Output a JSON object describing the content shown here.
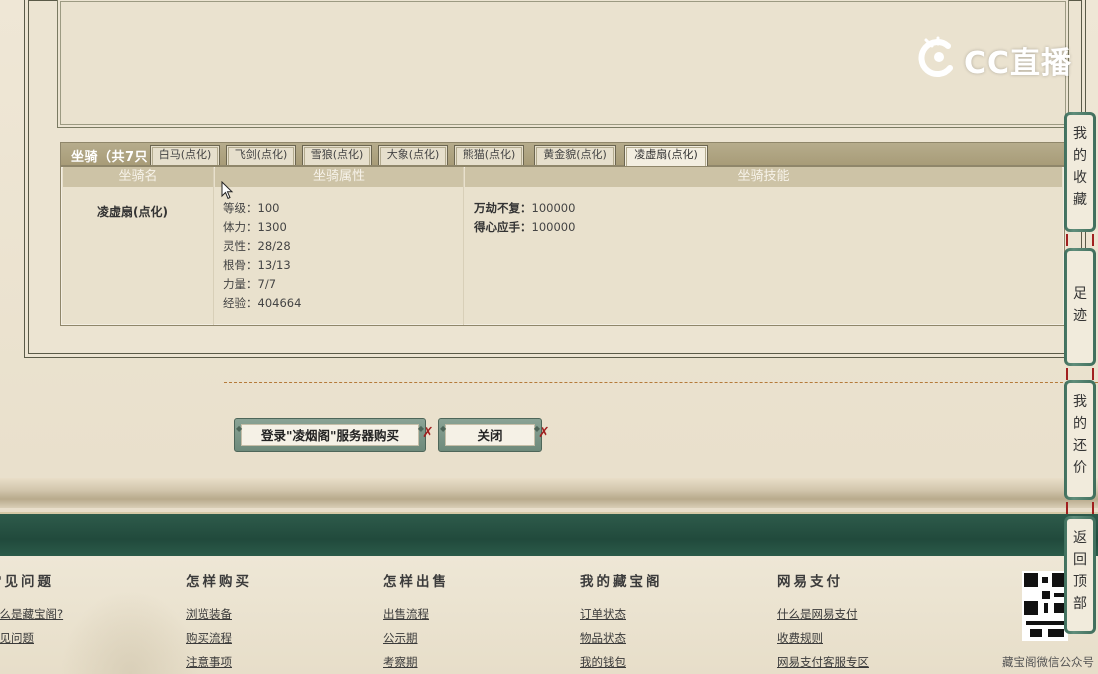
{
  "mounts_panel": {
    "title": "坐骑（共7只",
    "tabs": [
      {
        "label": "白马(点化)"
      },
      {
        "label": "飞剑(点化)"
      },
      {
        "label": "雪狼(点化)"
      },
      {
        "label": "大象(点化)"
      },
      {
        "label": "熊猫(点化)"
      },
      {
        "label": "黄金貌(点化)"
      },
      {
        "label": "凌虚扇(点化)",
        "active": true
      }
    ],
    "columns": {
      "name": "坐骑名",
      "attributes": "坐骑属性",
      "skills": "坐骑技能"
    },
    "selected_mount": {
      "name": "凌虚扇(点化)",
      "attributes": [
        "等级：100",
        "体力：1300",
        "灵性：28/28",
        "根骨：13/13",
        "力量：7/7",
        "经验：404664"
      ],
      "skills": [
        {
          "name": "万劫不复：",
          "value": "100000"
        },
        {
          "name": "得心应手：",
          "value": "100000"
        }
      ]
    }
  },
  "buttons": {
    "login_buy": "登录\"凌烟阁\"服务器购买",
    "close": "关闭"
  },
  "footer": {
    "columns": [
      {
        "title": "常见问题",
        "links": [
          "什么是藏宝阁?",
          "常见问题"
        ]
      },
      {
        "title": "怎样购买",
        "links": [
          "浏览装备",
          "购买流程",
          "注意事项"
        ]
      },
      {
        "title": "怎样出售",
        "links": [
          "出售流程",
          "公示期",
          "考察期"
        ]
      },
      {
        "title": "我的藏宝阁",
        "links": [
          "订单状态",
          "物品状态",
          "我的钱包"
        ]
      },
      {
        "title": "网易支付",
        "links": [
          "什么是网易支付",
          "收费规则",
          "网易支付客服专区"
        ]
      }
    ],
    "qr_caption": "藏宝阁微信公众号"
  },
  "side_tabs": [
    {
      "label": "我的收藏",
      "chars": [
        "我",
        "的",
        "收",
        "藏"
      ]
    },
    {
      "label": "足迹",
      "chars": [
        "足",
        "迹"
      ]
    },
    {
      "label": "我的还价",
      "chars": [
        "我",
        "的",
        "还",
        "价"
      ]
    },
    {
      "label": "返回顶部",
      "chars": [
        "返",
        "回",
        "顶",
        "部"
      ]
    }
  ],
  "watermark": {
    "text": "CC直播",
    "icon": "cc-live-logo-icon"
  },
  "colors": {
    "accent_green": "#2e5b4b",
    "tassel_red": "#a12020",
    "panel_beige": "#e9e1cd"
  }
}
